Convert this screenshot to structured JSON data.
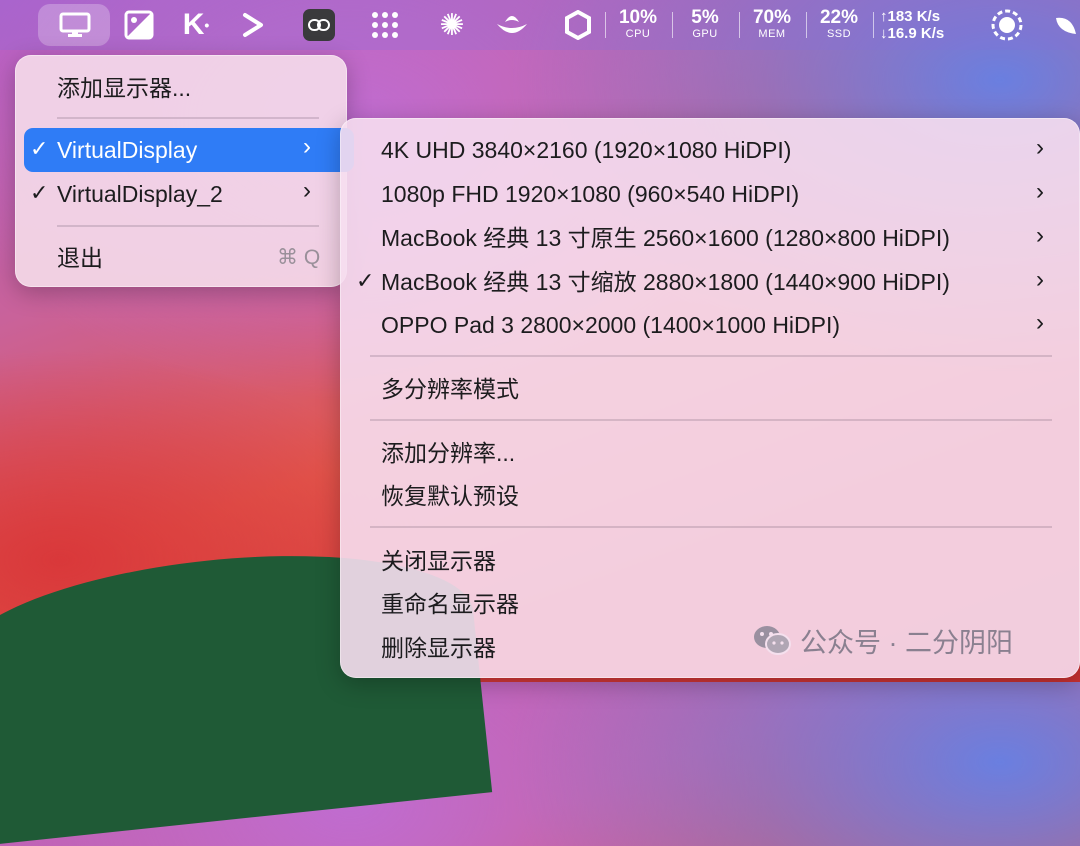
{
  "stats": [
    {
      "value": "10%",
      "label": "CPU"
    },
    {
      "value": "5%",
      "label": "GPU"
    },
    {
      "value": "70%",
      "label": "MEM"
    },
    {
      "value": "22%",
      "label": "SSD"
    }
  ],
  "network": {
    "upload": "↑183 K/s",
    "download": "↓16.9 K/s"
  },
  "menu_main": {
    "add_display": "添加显示器...",
    "virtual_display": "VirtualDisplay",
    "virtual_display_2": "VirtualDisplay_2",
    "quit": "退出",
    "quit_shortcut": "⌘ Q",
    "check": "✓",
    "chevron": "›"
  },
  "submenu": {
    "resolutions": [
      "4K UHD 3840×2160 (1920×1080 HiDPI)",
      "1080p FHD 1920×1080 (960×540 HiDPI)",
      "MacBook 经典 13 寸原生 2560×1600 (1280×800 HiDPI)",
      "MacBook 经典 13 寸缩放 2880×1800 (1440×900 HiDPI)",
      "OPPO Pad 3 2800×2000 (1400×1000 HiDPI)"
    ],
    "multi_resolution": "多分辨率模式",
    "add_resolution": "添加分辨率...",
    "restore_defaults": "恢复默认预设",
    "close_display": "关闭显示器",
    "rename_display": "重命名显示器",
    "delete_display": "删除显示器"
  },
  "watermark": "公众号 · 二分阴阳",
  "colors": {
    "accent": "#2f7cf6"
  }
}
